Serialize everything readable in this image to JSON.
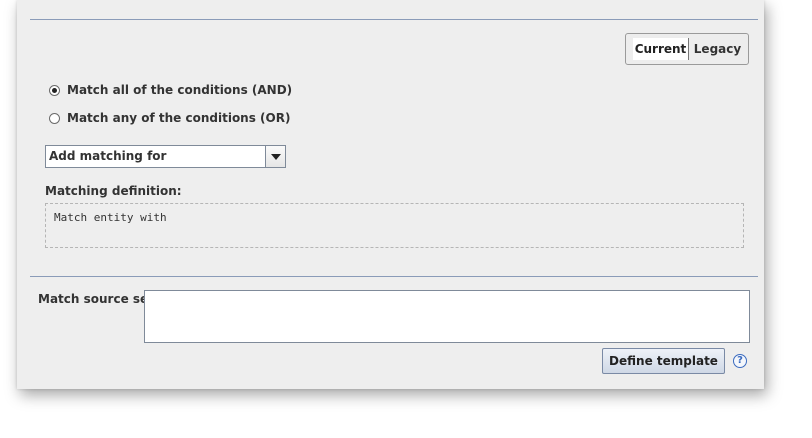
{
  "mode_toggle": {
    "current_label": "Current",
    "legacy_label": "Legacy",
    "selected": "Current"
  },
  "conditions": {
    "options": [
      {
        "label": "Match all of the conditions (AND)",
        "checked": true
      },
      {
        "label": "Match any of the conditions (OR)",
        "checked": false
      }
    ]
  },
  "add_matching": {
    "value": "Add matching for"
  },
  "definition": {
    "label": "Matching definition:",
    "text": "Match entity with"
  },
  "source_set": {
    "label": "Match source set:",
    "value": ""
  },
  "actions": {
    "define_template_label": "Define template",
    "help_glyph": "?"
  },
  "icons": {
    "help": "help-icon",
    "dropdown": "chevron-down-icon"
  },
  "colors": {
    "panel_bg": "#eeeeee",
    "separator": "#8a9bb8",
    "help_accent": "#3b6bbf"
  }
}
